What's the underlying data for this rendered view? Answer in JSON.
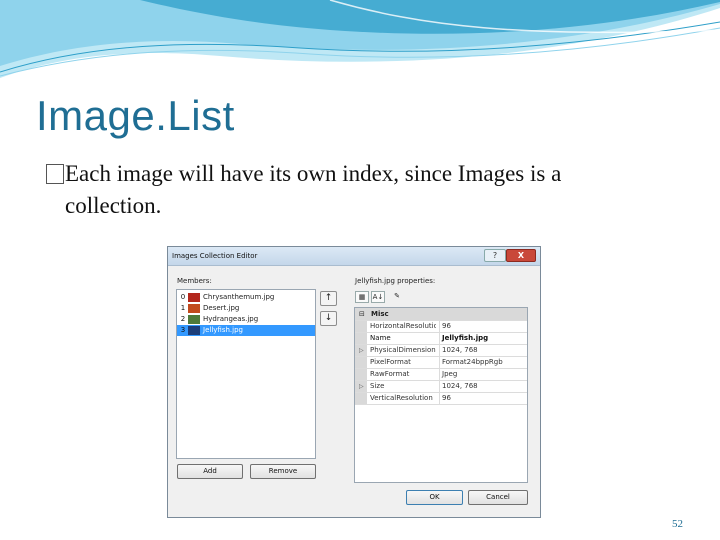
{
  "slide": {
    "title": "Image.List",
    "bullet_mark": "",
    "bullet_line1": "Each image will have its own index, since Images is a",
    "bullet_line2": "collection.",
    "page_number": "52"
  },
  "dialog": {
    "title": "Images Collection Editor",
    "help_label": "?",
    "close_label": "X",
    "members_label": "Members:",
    "properties_label": "Jellyfish.jpg properties:",
    "members": [
      {
        "index": "0",
        "name": "Chrysanthemum.jpg",
        "thumb_color": "#b3271c",
        "selected": false
      },
      {
        "index": "1",
        "name": "Desert.jpg",
        "thumb_color": "#c24a1d",
        "selected": false
      },
      {
        "index": "2",
        "name": "Hydrangeas.jpg",
        "thumb_color": "#4e7a3a",
        "selected": false
      },
      {
        "index": "3",
        "name": "Jellyfish.jpg",
        "thumb_color": "#1c3e7a",
        "selected": true
      }
    ],
    "move_up_label": "↑",
    "move_down_label": "↓",
    "categorized_label": "▦",
    "alphabetical_label": "A↓",
    "property_pages_label": "✎",
    "category": {
      "toggle": "⊟",
      "name": "Misc"
    },
    "properties": [
      {
        "expander": "",
        "name": "HorizontalResolutio",
        "value": "96",
        "bold": false
      },
      {
        "expander": "",
        "name": "Name",
        "value": "Jellyfish.jpg",
        "bold": true
      },
      {
        "expander": "▷",
        "name": "PhysicalDimension",
        "value": "1024, 768",
        "bold": false
      },
      {
        "expander": "",
        "name": "PixelFormat",
        "value": "Format24bppRgb",
        "bold": false
      },
      {
        "expander": "",
        "name": "RawFormat",
        "value": "Jpeg",
        "bold": false
      },
      {
        "expander": "▷",
        "name": "Size",
        "value": "1024, 768",
        "bold": false
      },
      {
        "expander": "",
        "name": "VerticalResolution",
        "value": "96",
        "bold": false
      }
    ],
    "add_label": "Add",
    "remove_label": "Remove",
    "ok_label": "OK",
    "cancel_label": "Cancel"
  },
  "colors": {
    "title": "#1f6e94",
    "selection": "#3399ff",
    "deco_light": "#8fd3ec",
    "deco_dark": "#2e9fc9"
  }
}
